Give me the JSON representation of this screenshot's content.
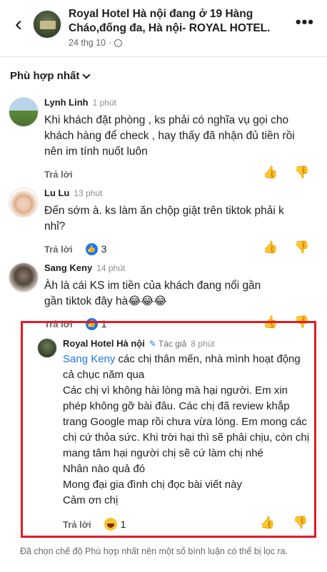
{
  "header": {
    "title": "Royal Hotel Hà nội đang ở 19 Hàng Cháo,đống đa, Hà nội- ROYAL HOTEL.",
    "date": "24 thg 10",
    "separator": "·",
    "more_label": "•••",
    "back_label": "‹"
  },
  "filter": {
    "label": "Phù hợp nhất"
  },
  "comments": [
    {
      "author": "Lynh Linh",
      "time": "1 phút",
      "text": "Khi khách đặt phòng , ks phải có nghĩa vụ gọi cho khách hàng để check , hay thấy đã  nhận đủ tiền rồi nên im tính nuốt luôn",
      "reply_label": "Trả lời"
    },
    {
      "author": "Lu Lu",
      "time": "13 phút",
      "text": "Đến sớm à. ks làm ăn chộp giật trên tiktok phải k nhỉ?",
      "reply_label": "Trả lời",
      "reaction_count": "3"
    },
    {
      "author": "Sang Keny",
      "time": "14 phút",
      "text": "Àh là cái KS im tiền của khách đang nổi gần gần tiktok đây hà😂😂😂",
      "reply_label": "Trả lời",
      "reaction_count": "1"
    },
    {
      "author": "Royal Hotel Hà nội",
      "author_badge": "Tác giả",
      "time": "8 phút",
      "mention": "Sang Keny",
      "text": " các chị thân mến, nhà mình hoạt động cả chục năm qua\nCác chị vì không hài lòng mà hại người. Em xin phép không gỡ bài đâu. Các chị đã review khắp trang Google map rồi chưa vừa lòng. Em mong các chị cứ thỏa sức. Khi trời hại thì sẽ phải chịu, còn chị mang tâm hại người chị sẽ cứ làm chị nhé\nNhân nào quả đó\nMong đại gia đình chị đọc bài viết này\nCảm ơn chị",
      "reply_label": "Trả lời",
      "reaction_count": "1"
    }
  ],
  "footer": {
    "note": "Đã chọn chế độ Phù hợp nhất nên một số bình luận có thể bị lọc ra."
  },
  "colors": {
    "highlight": "#e21b24",
    "link": "#1877f2"
  }
}
